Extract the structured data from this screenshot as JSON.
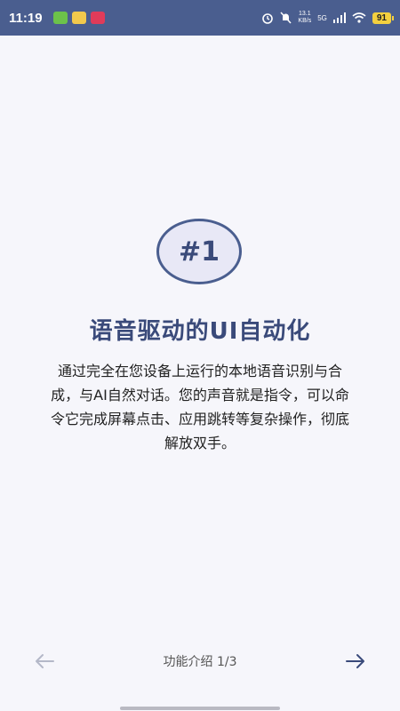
{
  "status_bar": {
    "time": "11:19",
    "net_speed_value": "13.1",
    "net_speed_unit": "KB/s",
    "network": "5G",
    "battery": "91"
  },
  "intro": {
    "badge": "#1",
    "title": "语音驱动的UI自动化",
    "description": "通过完全在您设备上运行的本地语音识别与合成，与AI自然对话。您的声音就是指令，可以命令它完成屏幕点击、应用跳转等复杂操作，彻底解放双手。"
  },
  "nav": {
    "indicator": "功能介绍 1/3",
    "prev_icon": "arrow-left-icon",
    "next_icon": "arrow-right-icon"
  },
  "colors": {
    "status_bar_bg": "#4a5e8f",
    "accent": "#3a4a7a",
    "background": "#f6f6fb",
    "prev_disabled": "#b4b8c8"
  }
}
